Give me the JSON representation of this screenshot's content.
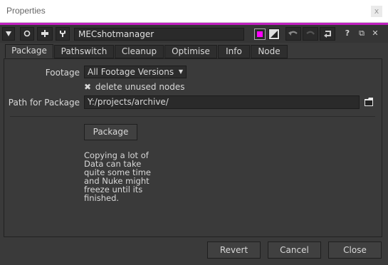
{
  "window": {
    "title": "Properties",
    "close_glyph": "x"
  },
  "node": {
    "name": "MECshotmanager",
    "accent_color": "#c020c0",
    "swatch_color": "#ff00ff"
  },
  "toolbar_icons": [
    "collapse-triangle-icon",
    "viewer-circle-icon",
    "pin-icon",
    "wrench-icon",
    "color-swatch-icon",
    "checker-swatch-icon",
    "undo-icon",
    "redo-icon",
    "revert-icon",
    "help-icon",
    "float-icon",
    "close-icon"
  ],
  "toolbar": {
    "help_glyph": "?",
    "float_glyph": "⧉",
    "close_glyph": "✕"
  },
  "tabs": [
    "Package",
    "Pathswitch",
    "Cleanup",
    "Optimise",
    "Info",
    "Node"
  ],
  "form": {
    "footage_label": "Footage",
    "footage_value": "All Footage Versions",
    "delete_label": "delete unused nodes",
    "delete_checked": true,
    "path_label": "Path for Package",
    "path_value": "Y:/projects/archive/",
    "package_button": "Package",
    "note_lines": [
      "Copying a lot of",
      "Data can take",
      "quite some time",
      "and Nuke might",
      "freeze until its",
      "finished."
    ]
  },
  "footer": {
    "revert": "Revert",
    "cancel": "Cancel",
    "close": "Close"
  }
}
